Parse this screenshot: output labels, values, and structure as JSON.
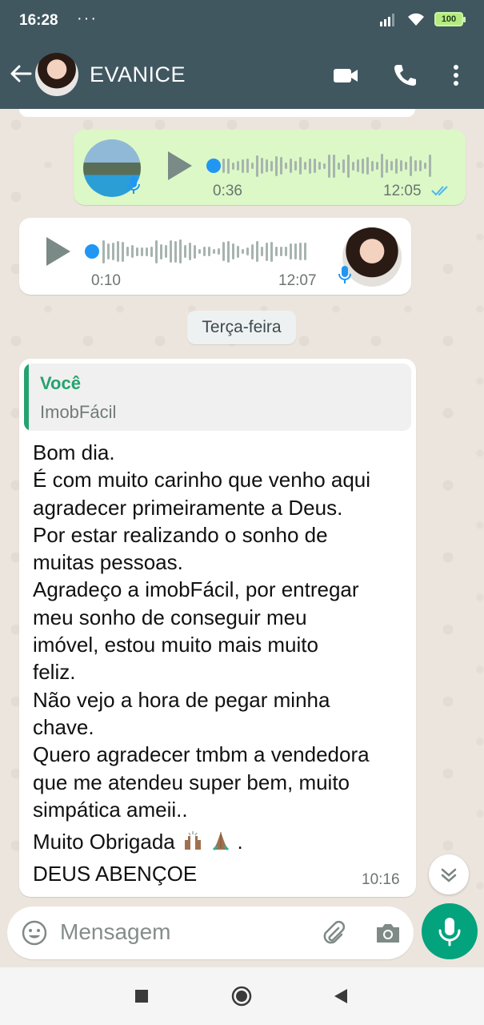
{
  "status_bar": {
    "time": "16:28",
    "dots": "···",
    "battery": "100",
    "icons": [
      "signal-icon",
      "wifi-icon",
      "battery-icon"
    ]
  },
  "header": {
    "contact_name": "EVANICE",
    "actions": [
      "back-arrow-icon",
      "video-call-icon",
      "phone-icon",
      "more-vert-icon"
    ]
  },
  "messages": [
    {
      "type": "audio",
      "direction": "outgoing",
      "duration": "0:36",
      "time": "12:05",
      "read": true,
      "progress": 0.0
    },
    {
      "type": "audio",
      "direction": "incoming",
      "duration": "0:10",
      "time": "12:07",
      "progress": 0.0
    }
  ],
  "date_separator": "Terça-feira",
  "text_message": {
    "quote_author": "Você",
    "quote_text": "ImobFácil",
    "lines": [
      "Bom dia.",
      "É com muito carinho que venho aqui",
      "agradecer primeiramente a Deus.",
      "Por estar realizando o sonho de",
      "muitas pessoas.",
      "Agradeço a imobFácil, por entregar",
      "meu sonho de conseguir meu",
      "imóvel, estou muito mais muito",
      "feliz.",
      "Não vejo a hora de pegar minha",
      "chave.",
      "Quero agradecer tmbm a vendedora",
      "que me atendeu super bem, muito",
      "simpática ameii..",
      "Muito Obrigada",
      "DEUS ABENÇOE"
    ],
    "trailing_after_emojis": ".",
    "emojis": [
      "raising-hands-emoji",
      "folded-hands-emoji"
    ],
    "time": "10:16"
  },
  "composer": {
    "placeholder": "Mensagem",
    "icons": [
      "emoji-icon",
      "attach-icon",
      "camera-icon",
      "mic-icon"
    ]
  },
  "colors": {
    "header": "#405760",
    "outgoing_bubble": "#dcf8c6",
    "accent_green": "#03a37e",
    "quote_green": "#25a26e",
    "audio_blue": "#2196f3"
  }
}
